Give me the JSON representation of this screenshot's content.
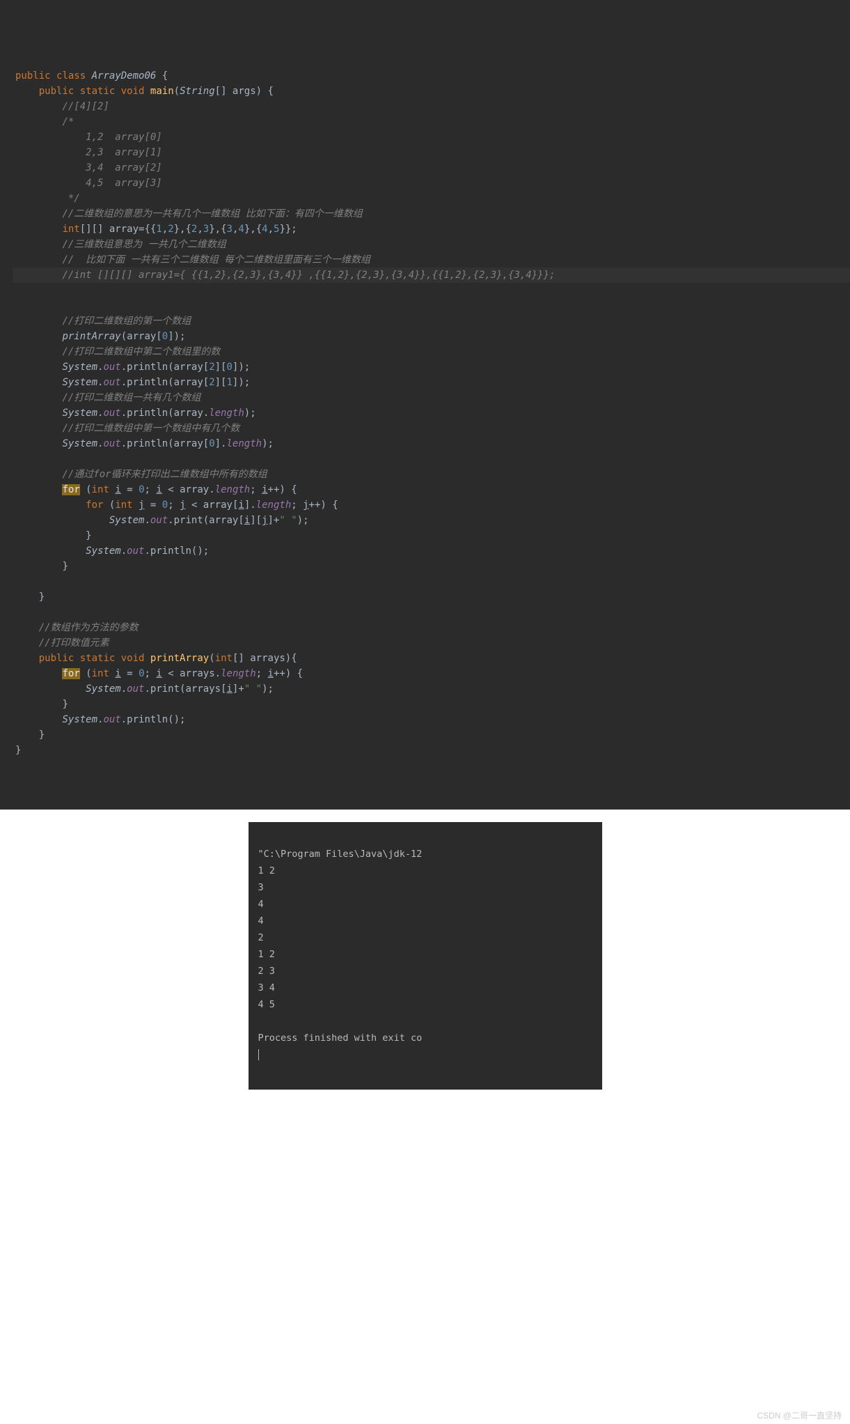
{
  "code": {
    "l1_a": "public",
    "l1_b": "class",
    "l1_c": "ArrayDemo06",
    "l1_d": "{",
    "l2_a": "public",
    "l2_b": "static",
    "l2_c": "void",
    "l2_d": "main",
    "l2_e": "(",
    "l2_f": "String",
    "l2_g": "[] args) {",
    "l3": "//[4][2]",
    "l4": "/*",
    "l5": "    1,2  array[0]",
    "l6": "    2,3  array[1]",
    "l7": "    3,4  array[2]",
    "l8": "    4,5  array[3]",
    "l9": " */",
    "l10": "//二维数组的意思为一共有几个一维数组 比如下面：有四个一维数组",
    "l11_a": "int",
    "l11_b": "[][] array={{",
    "l11_c": "1",
    "l11_d": ",",
    "l11_e": "2",
    "l11_f": "},{",
    "l11_g": "2",
    "l11_h": ",",
    "l11_i": "3",
    "l11_j": "},{",
    "l11_k": "3",
    "l11_l": ",",
    "l11_m": "4",
    "l11_n": "},{",
    "l11_o": "4",
    "l11_p": ",",
    "l11_q": "5",
    "l11_r": "}};",
    "l12": "//三维数组意思为 一共几个二维数组",
    "l13": "//  比如下面 一共有三个二维数组 每个二维数组里面有三个一维数组",
    "l14": "//int [][][] array1={ {{1,2},{2,3},{3,4}} ,{{1,2},{2,3},{3,4}},{{1,2},{2,3},{3,4}}};",
    "l15": "//打印二维数组的第一个数组",
    "l16_a": "printArray",
    "l16_b": "(array[",
    "l16_c": "0",
    "l16_d": "]);",
    "l17": "//打印二维数组中第二个数组里的数",
    "l18_a": "System",
    "l18_b": ".",
    "l18_c": "out",
    "l18_d": ".println(array[",
    "l18_e": "2",
    "l18_f": "][",
    "l18_g": "0",
    "l18_h": "]);",
    "l19_a": "System",
    "l19_b": ".",
    "l19_c": "out",
    "l19_d": ".println(array[",
    "l19_e": "2",
    "l19_f": "][",
    "l19_g": "1",
    "l19_h": "]);",
    "l20": "//打印二维数组一共有几个数组",
    "l21_a": "System",
    "l21_b": ".",
    "l21_c": "out",
    "l21_d": ".println(array.",
    "l21_e": "length",
    "l21_f": ");",
    "l22": "//打印二维数组中第一个数组中有几个数",
    "l23_a": "System",
    "l23_b": ".",
    "l23_c": "out",
    "l23_d": ".println(array[",
    "l23_e": "0",
    "l23_f": "].",
    "l23_g": "length",
    "l23_h": ");",
    "l24": "//通过for循环来打印出二维数组中所有的数组",
    "l25_a": "for",
    "l25_b": " (",
    "l25_c": "int",
    "l25_d": " ",
    "l25_e": "i",
    "l25_f": " = ",
    "l25_g": "0",
    "l25_h": "; ",
    "l25_i": "i",
    "l25_j": " < array.",
    "l25_k": "length",
    "l25_l": "; ",
    "l25_m": "i",
    "l25_n": "++) {",
    "l26_a": "for",
    "l26_b": " (",
    "l26_c": "int",
    "l26_d": " ",
    "l26_e": "j",
    "l26_f": " = ",
    "l26_g": "0",
    "l26_h": "; ",
    "l26_i": "j",
    "l26_j": " < array[",
    "l26_k": "i",
    "l26_l": "].",
    "l26_m": "length",
    "l26_n": "; ",
    "l26_o": "j",
    "l26_p": "++) {",
    "l27_a": "System",
    "l27_b": ".",
    "l27_c": "out",
    "l27_d": ".print(array[",
    "l27_e": "i",
    "l27_f": "][",
    "l27_g": "j",
    "l27_h": "]+",
    "l27_i": "\" \"",
    "l27_j": ");",
    "l28": "}",
    "l29_a": "System",
    "l29_b": ".",
    "l29_c": "out",
    "l29_d": ".println();",
    "l30": "}",
    "l31": "}",
    "l32": "//数组作为方法的参数",
    "l33": "//打印数值元素",
    "l34_a": "public",
    "l34_b": "static",
    "l34_c": "void",
    "l34_d": "printArray",
    "l34_e": "(",
    "l34_f": "int",
    "l34_g": "[] arrays){",
    "l35_a": "for",
    "l35_b": " (",
    "l35_c": "int",
    "l35_d": " ",
    "l35_e": "i",
    "l35_f": " = ",
    "l35_g": "0",
    "l35_h": "; ",
    "l35_i": "i",
    "l35_j": " < arrays.",
    "l35_k": "length",
    "l35_l": "; ",
    "l35_m": "i",
    "l35_n": "++) {",
    "l36_a": "System",
    "l36_b": ".",
    "l36_c": "out",
    "l36_d": ".print(arrays[",
    "l36_e": "i",
    "l36_f": "]+",
    "l36_g": "\" \"",
    "l36_h": ");",
    "l37": "}",
    "l38_a": "System",
    "l38_b": ".",
    "l38_c": "out",
    "l38_d": ".println();",
    "l39": "}",
    "l40": "}"
  },
  "console": {
    "lines": [
      "\"C:\\Program Files\\Java\\jdk-12",
      "1 2 ",
      "3",
      "4",
      "4",
      "2",
      "1 2 ",
      "2 3 ",
      "3 4 ",
      "4 5 ",
      "",
      "Process finished with exit co"
    ]
  },
  "watermark": "CSDN @二哥一直坚持"
}
